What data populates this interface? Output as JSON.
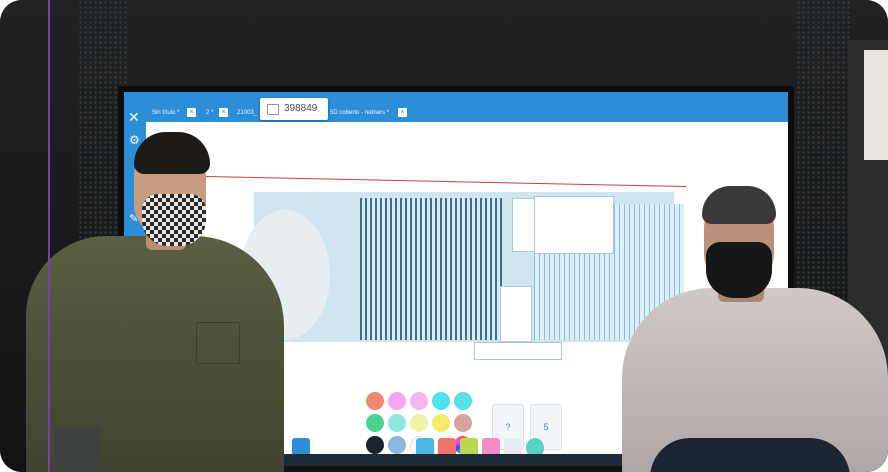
{
  "scene": {
    "description_kind": "photo",
    "colors": {
      "accent_line": "#7b3fa8",
      "app_blue": "#2d8ed8",
      "wall": "#1a1c1d"
    }
  },
  "app": {
    "tabs": [
      {
        "label": "Sin título *"
      },
      {
        "label": "2 *"
      },
      {
        "label": "21003_"
      },
      {
        "label": "5D coberto - redners *"
      }
    ],
    "badge_value": "398849",
    "cards": [
      "?",
      "5"
    ]
  }
}
